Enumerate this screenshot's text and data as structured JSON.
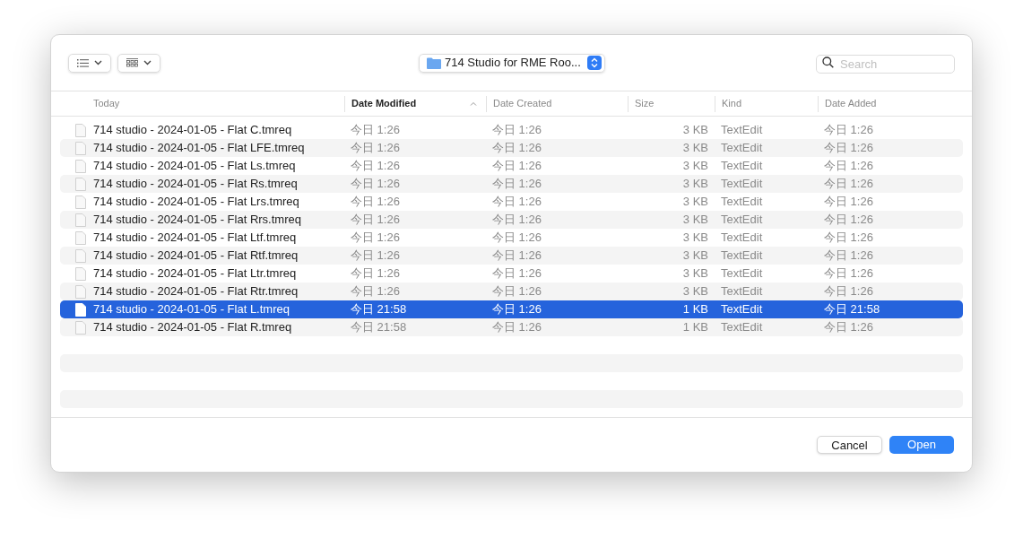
{
  "toolbar": {
    "location": "714 Studio for RME Roo...",
    "search": {
      "placeholder": "Search"
    }
  },
  "columns": [
    {
      "label": "Today",
      "sorted": false
    },
    {
      "label": "Date Modified",
      "sorted": true
    },
    {
      "label": "Date Created",
      "sorted": false
    },
    {
      "label": "Size",
      "sorted": false
    },
    {
      "label": "Kind",
      "sorted": false
    },
    {
      "label": "Date Added",
      "sorted": false
    }
  ],
  "rows": [
    {
      "name": "714 studio - 2024-01-05 - Flat C.tmreq",
      "modified": "今日 1:26",
      "created": "今日 1:26",
      "size": "3 KB",
      "kind": "TextEdit",
      "added": "今日 1:26",
      "selected": false
    },
    {
      "name": "714 studio - 2024-01-05 - Flat LFE.tmreq",
      "modified": "今日 1:26",
      "created": "今日 1:26",
      "size": "3 KB",
      "kind": "TextEdit",
      "added": "今日 1:26",
      "selected": false
    },
    {
      "name": "714 studio - 2024-01-05 - Flat Ls.tmreq",
      "modified": "今日 1:26",
      "created": "今日 1:26",
      "size": "3 KB",
      "kind": "TextEdit",
      "added": "今日 1:26",
      "selected": false
    },
    {
      "name": "714 studio - 2024-01-05 - Flat Rs.tmreq",
      "modified": "今日 1:26",
      "created": "今日 1:26",
      "size": "3 KB",
      "kind": "TextEdit",
      "added": "今日 1:26",
      "selected": false
    },
    {
      "name": "714 studio - 2024-01-05 - Flat Lrs.tmreq",
      "modified": "今日 1:26",
      "created": "今日 1:26",
      "size": "3 KB",
      "kind": "TextEdit",
      "added": "今日 1:26",
      "selected": false
    },
    {
      "name": "714 studio - 2024-01-05 - Flat Rrs.tmreq",
      "modified": "今日 1:26",
      "created": "今日 1:26",
      "size": "3 KB",
      "kind": "TextEdit",
      "added": "今日 1:26",
      "selected": false
    },
    {
      "name": "714 studio - 2024-01-05 - Flat Ltf.tmreq",
      "modified": "今日 1:26",
      "created": "今日 1:26",
      "size": "3 KB",
      "kind": "TextEdit",
      "added": "今日 1:26",
      "selected": false
    },
    {
      "name": "714 studio - 2024-01-05 - Flat Rtf.tmreq",
      "modified": "今日 1:26",
      "created": "今日 1:26",
      "size": "3 KB",
      "kind": "TextEdit",
      "added": "今日 1:26",
      "selected": false
    },
    {
      "name": "714 studio - 2024-01-05 - Flat Ltr.tmreq",
      "modified": "今日 1:26",
      "created": "今日 1:26",
      "size": "3 KB",
      "kind": "TextEdit",
      "added": "今日 1:26",
      "selected": false
    },
    {
      "name": "714 studio - 2024-01-05 - Flat Rtr.tmreq",
      "modified": "今日 1:26",
      "created": "今日 1:26",
      "size": "3 KB",
      "kind": "TextEdit",
      "added": "今日 1:26",
      "selected": false
    },
    {
      "name": "714 studio - 2024-01-05 - Flat L.tmreq",
      "modified": "今日 21:58",
      "created": "今日 1:26",
      "size": "1 KB",
      "kind": "TextEdit",
      "added": "今日 21:58",
      "selected": true
    },
    {
      "name": "714 studio - 2024-01-05 - Flat R.tmreq",
      "modified": "今日 21:58",
      "created": "今日 1:26",
      "size": "1 KB",
      "kind": "TextEdit",
      "added": "今日 1:26",
      "selected": false
    }
  ],
  "buttons": {
    "cancel": "Cancel",
    "open": "Open"
  }
}
